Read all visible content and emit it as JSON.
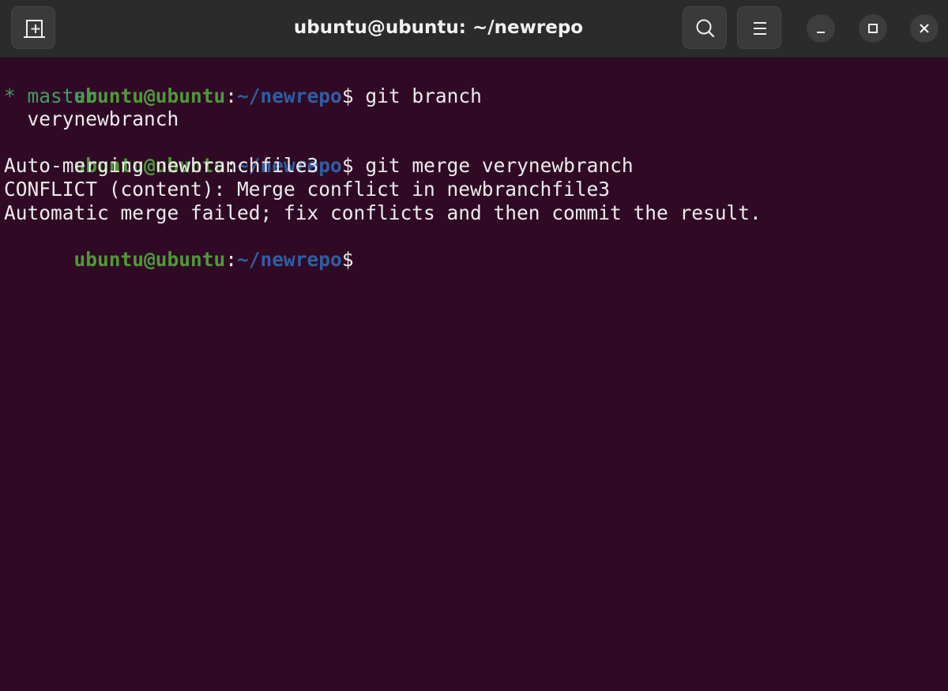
{
  "window": {
    "title": "ubuntu@ubuntu: ~/newrepo"
  },
  "icons": {
    "new_tab": "new-tab-icon",
    "search": "search-icon",
    "menu": "hamburger-menu-icon",
    "minimize": "minimize-icon",
    "maximize": "maximize-icon",
    "close": "close-icon"
  },
  "colors": {
    "background": "#300a24",
    "titlebar": "#2b2b2b",
    "prompt_user": "#4e9a3a",
    "prompt_path": "#2f5ea3",
    "text": "#ececec",
    "current_branch": "#3f9e63"
  },
  "terminal": {
    "prompt": {
      "user_host": "ubuntu@ubuntu",
      "colon": ":",
      "path": "~/newrepo",
      "dollar": "$"
    },
    "lines": [
      {
        "type": "prompt",
        "command": " git branch"
      },
      {
        "type": "output",
        "text": "* master",
        "color": "green"
      },
      {
        "type": "output",
        "text": "  verynewbranch"
      },
      {
        "type": "prompt",
        "command": " git merge verynewbranch"
      },
      {
        "type": "output",
        "text": "Auto-merging newbranchfile3"
      },
      {
        "type": "output",
        "text": "CONFLICT (content): Merge conflict in newbranchfile3"
      },
      {
        "type": "output",
        "text": "Automatic merge failed; fix conflicts and then commit the result."
      },
      {
        "type": "prompt",
        "command": ""
      }
    ]
  }
}
